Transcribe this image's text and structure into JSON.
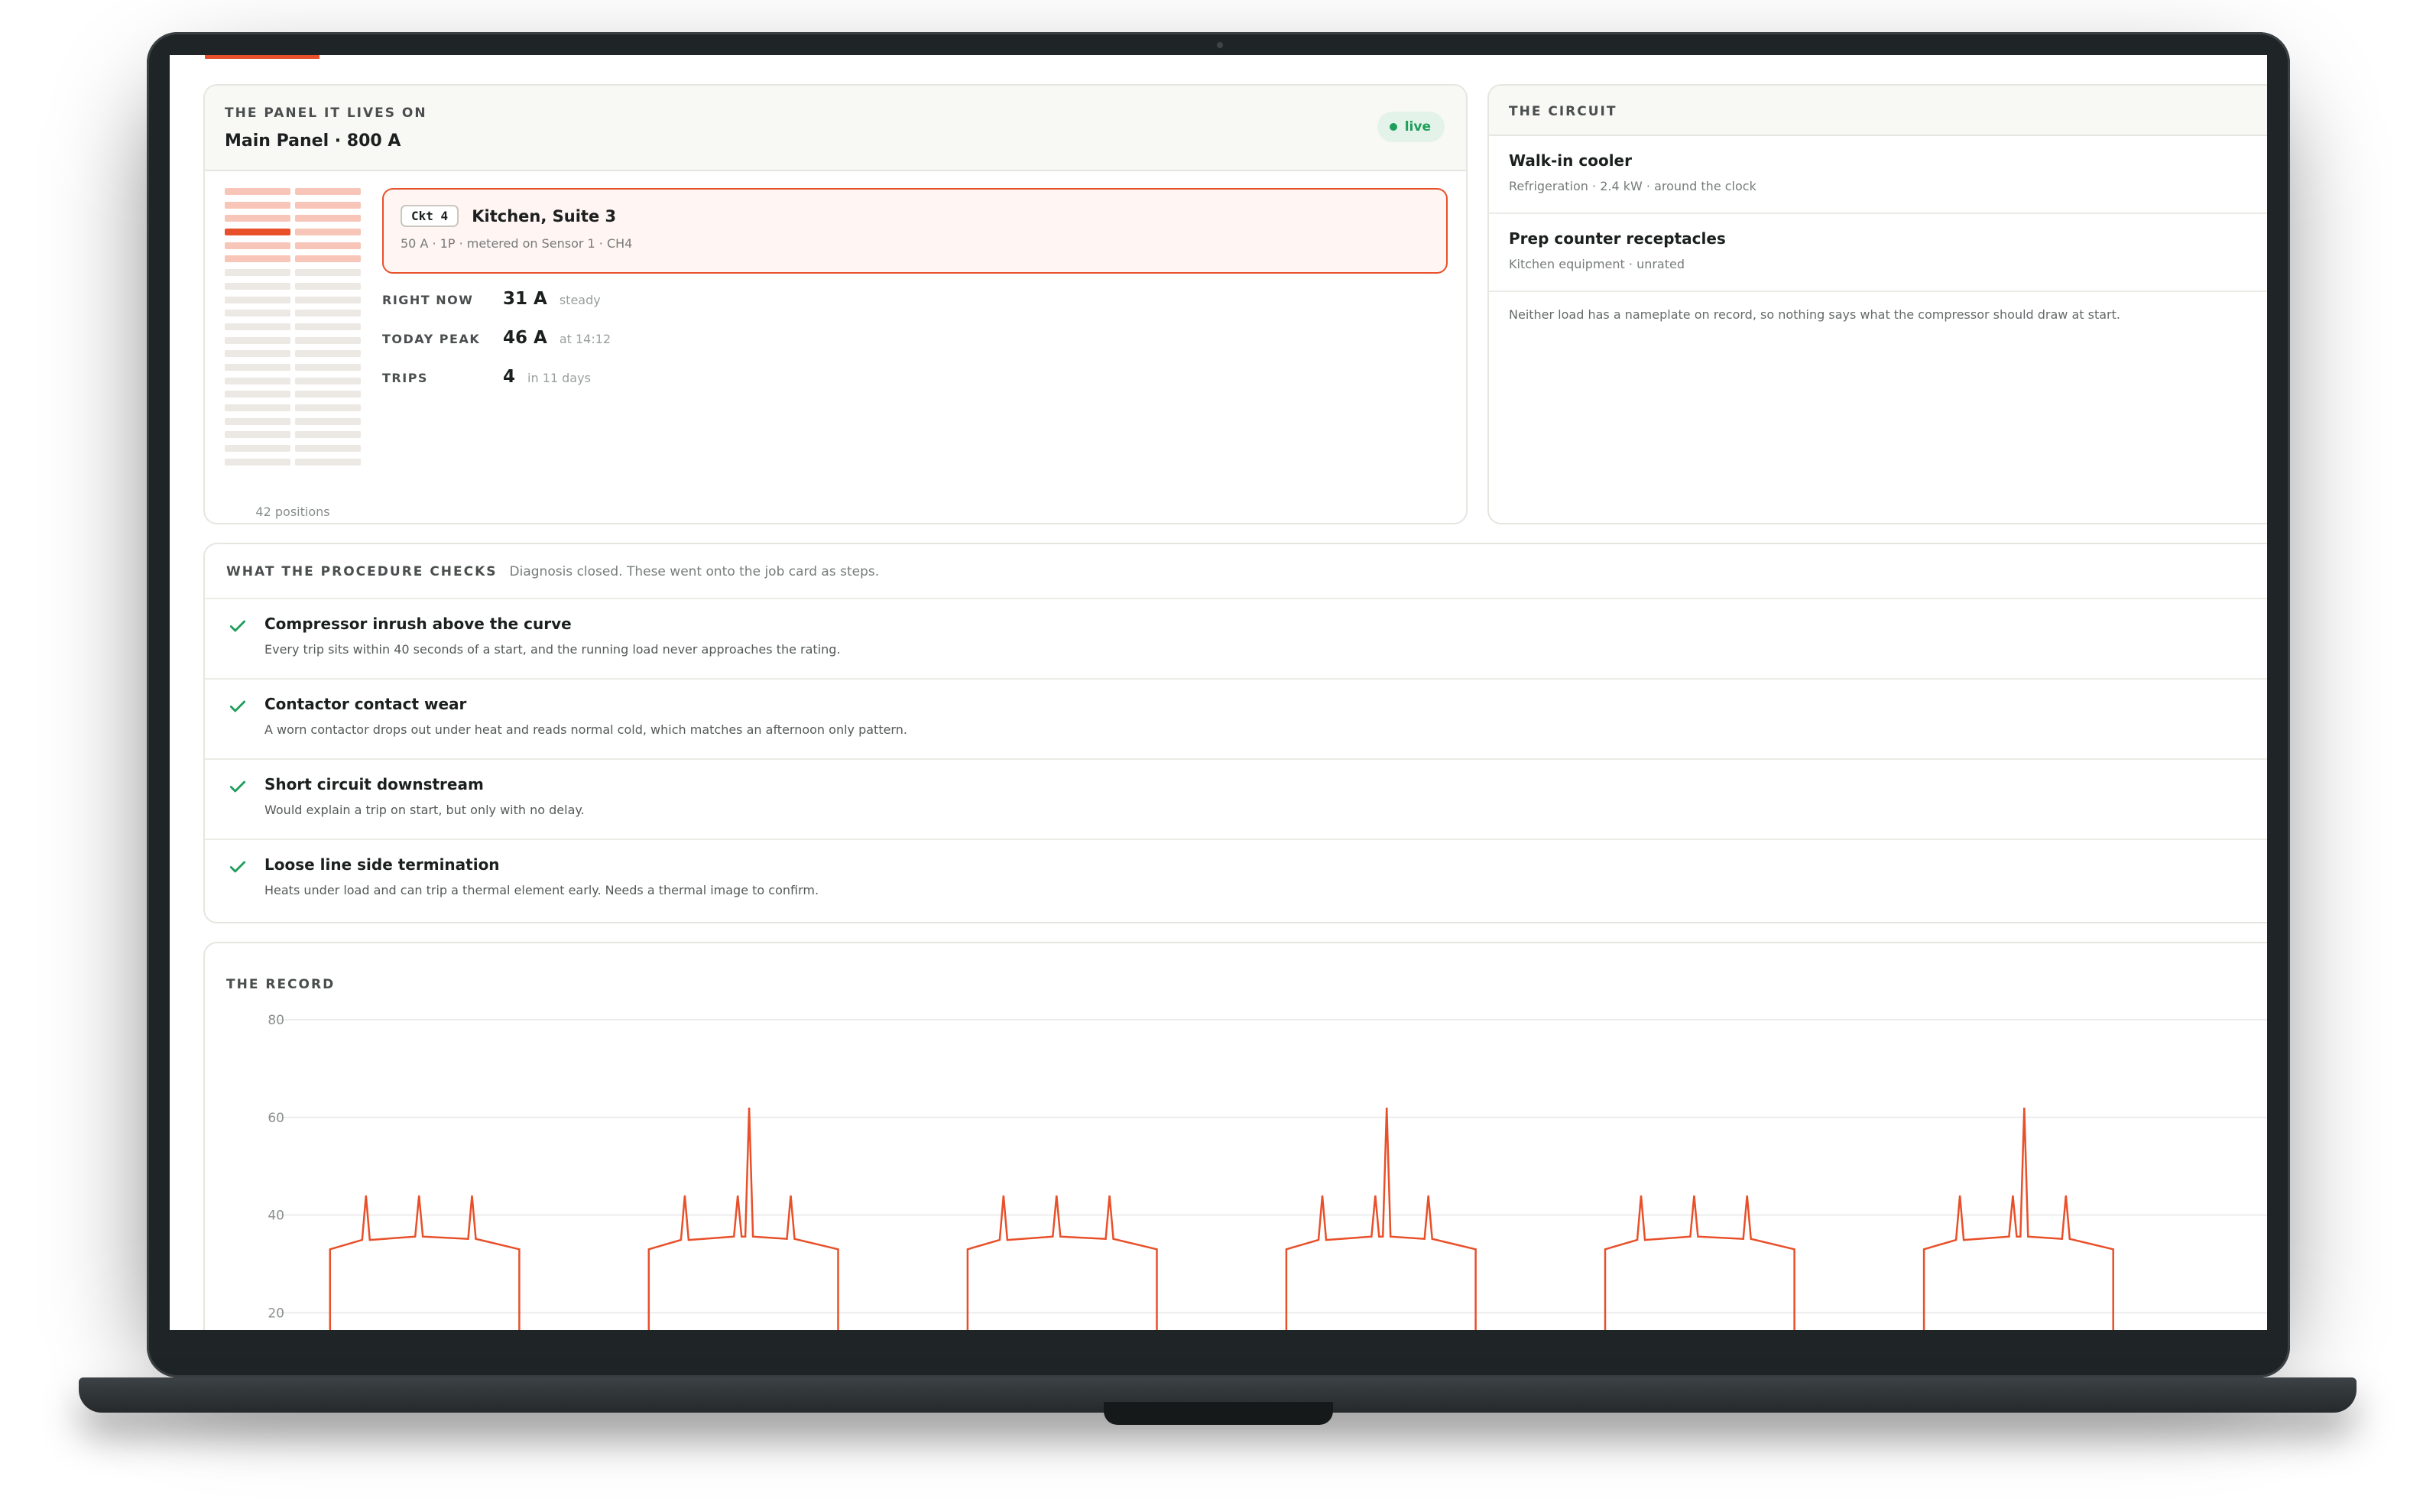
{
  "panel": {
    "eyebrow": "THE PANEL IT LIVES ON",
    "title": "Main Panel · 800 A",
    "status": "live",
    "positions_label": "42 positions",
    "active_position": 4
  },
  "circuit_box": {
    "tag": "Ckt 4",
    "name": "Kitchen, Suite 3",
    "detail": "50 A · 1P · metered on Sensor 1 · CH4"
  },
  "metrics": [
    {
      "key": "RIGHT NOW",
      "value": "31 A",
      "note": "steady"
    },
    {
      "key": "TODAY PEAK",
      "value": "46 A",
      "note": "at 14:12"
    },
    {
      "key": "TRIPS",
      "value": "4",
      "note": "in 11 days"
    }
  ],
  "circuit": {
    "eyebrow": "THE CIRCUIT",
    "loads": [
      {
        "name": "Walk-in cooler",
        "detail": "Refrigeration · 2.4 kW · around the clock"
      },
      {
        "name": "Prep counter receptacles",
        "detail": "Kitchen equipment · unrated"
      }
    ],
    "note": "Neither load has a nameplate on record, so nothing says what the compressor should draw at start."
  },
  "checks": {
    "eyebrow": "WHAT THE PROCEDURE CHECKS",
    "description": "Diagnosis closed. These went onto the job card as steps.",
    "items": [
      {
        "title": "Compressor inrush above the curve",
        "detail": "Every trip sits within 40 seconds of a start, and the running load never approaches the rating.",
        "icon": "check-icon"
      },
      {
        "title": "Contactor contact wear",
        "detail": "A worn contactor drops out under heat and reads normal cold, which matches an afternoon only pattern.",
        "icon": "check-icon"
      },
      {
        "title": "Short circuit downstream",
        "detail": "Would explain a trip on start, but only with no delay.",
        "icon": "check-icon"
      },
      {
        "title": "Loose line side termination",
        "detail": "Heats under load and can trip a thermal element early. Needs a thermal image to confirm.",
        "icon": "check-icon"
      }
    ]
  },
  "record": {
    "eyebrow": "THE RECORD"
  },
  "colors": {
    "accent": "#e8502a",
    "success": "#1f9d5a",
    "grid": "#ececec"
  },
  "chart_data": {
    "type": "line",
    "title": "",
    "xlabel": "",
    "ylabel": "",
    "y_ticks": [
      80,
      60,
      40,
      20
    ],
    "ylim": [
      8,
      80
    ],
    "x": [
      0,
      1,
      2,
      3,
      4,
      5,
      6,
      7,
      8,
      9,
      10,
      11,
      12,
      13,
      14,
      15,
      16,
      17,
      18,
      19,
      20,
      21,
      22,
      23,
      24,
      25,
      26,
      27,
      28,
      29,
      30,
      31,
      32,
      33,
      34,
      35,
      36,
      37,
      38,
      39,
      40,
      41,
      42,
      43,
      44,
      45,
      46,
      47,
      48,
      49,
      50,
      51,
      52,
      53,
      54,
      55,
      56,
      57,
      58,
      59,
      60,
      61,
      62,
      63,
      64,
      65,
      66,
      67,
      68,
      69,
      70,
      71,
      72,
      73,
      74,
      75,
      76,
      77,
      78,
      79,
      80,
      81,
      82,
      83,
      84,
      85,
      86,
      87,
      88,
      89,
      90,
      91,
      92,
      93,
      94,
      95,
      96,
      97,
      98,
      99,
      100,
      101,
      102,
      103,
      104,
      105,
      106,
      107,
      108,
      109,
      110,
      111,
      112,
      113,
      114,
      115,
      116,
      117,
      118,
      119,
      120,
      121,
      122,
      123,
      124,
      125,
      126,
      127,
      128,
      129,
      130,
      131,
      132,
      133,
      134,
      135,
      136,
      137,
      138,
      139,
      140,
      141,
      142,
      143,
      144,
      145,
      146,
      147,
      148,
      149,
      150,
      151,
      152,
      153,
      154,
      155,
      156,
      157,
      158,
      159,
      160,
      161,
      162,
      163,
      164,
      165,
      166,
      167,
      168,
      169,
      170,
      171,
      172,
      173,
      174,
      175,
      176,
      177,
      178,
      179,
      180,
      181,
      182,
      183,
      184,
      185,
      186,
      187,
      188,
      189,
      190,
      191,
      192,
      193,
      194,
      195,
      196,
      197,
      198,
      199,
      200,
      201,
      202,
      203,
      204,
      205,
      206,
      207,
      208,
      209,
      210,
      211,
      212,
      213,
      214,
      215,
      216,
      217,
      218,
      219,
      220,
      221,
      222,
      223,
      224,
      225,
      226,
      227,
      228,
      229,
      230,
      231,
      232,
      233,
      234,
      235,
      236,
      237,
      238,
      239,
      240,
      241,
      242,
      243,
      244,
      245,
      246,
      247,
      248,
      249,
      250,
      251,
      252,
      253,
      254,
      255,
      256,
      257,
      258,
      259,
      260,
      261,
      262,
      263,
      264,
      265,
      266,
      267,
      268,
      269,
      270,
      271,
      272,
      273,
      274,
      275,
      276,
      277,
      278,
      279,
      280,
      281,
      282,
      283,
      284,
      285,
      286,
      287,
      288,
      289,
      290,
      291,
      292,
      293,
      294,
      295,
      296,
      297,
      298,
      299,
      300,
      301,
      302,
      303,
      304,
      305,
      306,
      307,
      308,
      309,
      310,
      311,
      312,
      313,
      314,
      315,
      316,
      317,
      318,
      319,
      320,
      321,
      322,
      323,
      324,
      325,
      326,
      327,
      328,
      329,
      330,
      331,
      332,
      333,
      334,
      335,
      336,
      337,
      338,
      339,
      340,
      341,
      342,
      343,
      344,
      345,
      346,
      347,
      348,
      349,
      350,
      351,
      352,
      353,
      354,
      355,
      356,
      357,
      358,
      359,
      360,
      361,
      362,
      363,
      364,
      365,
      366,
      367,
      368,
      369,
      370,
      371,
      372,
      373,
      374,
      375,
      376,
      377,
      378,
      379,
      380,
      381,
      382,
      383,
      384,
      385,
      386,
      387,
      388,
      389,
      390,
      391,
      392,
      393,
      394,
      395,
      396,
      397,
      398,
      399,
      400,
      401,
      402,
      403,
      404,
      405,
      406,
      407,
      408,
      409,
      410,
      411,
      412,
      413,
      414,
      415,
      416,
      417,
      418,
      419,
      420,
      421,
      422,
      423,
      424,
      425,
      426,
      427,
      428,
      429,
      430,
      431,
      432,
      433,
      434,
      435,
      436,
      437,
      438,
      439,
      440,
      441,
      442,
      443,
      444,
      445,
      446,
      447,
      448,
      449,
      450,
      451,
      452,
      453,
      454,
      455,
      456,
      457,
      458,
      459,
      460,
      461,
      462,
      463,
      464,
      465,
      466,
      467,
      468,
      469,
      470,
      471,
      472,
      473,
      474,
      475,
      476,
      477,
      478,
      479,
      480,
      481,
      482,
      483,
      484,
      485,
      486,
      487,
      488,
      489,
      490,
      491,
      492,
      493,
      494,
      495,
      496,
      497,
      498,
      499,
      500,
      501,
      502,
      503,
      504,
      505,
      506,
      507,
      508,
      509,
      510,
      511,
      512,
      513,
      514,
      515,
      516,
      517,
      518,
      519,
      520,
      521,
      522,
      523,
      524,
      525,
      526,
      527,
      528,
      529,
      530,
      531,
      532,
      533,
      534,
      535,
      536,
      537,
      538,
      539,
      540,
      541,
      542,
      543,
      544,
      545,
      546,
      547,
      548,
      549,
      550,
      551,
      552,
      553,
      554,
      555,
      556,
      557,
      558,
      559,
      560,
      561,
      562,
      563,
      564,
      565,
      566,
      567,
      568,
      569,
      570,
      571,
      572,
      573,
      574,
      575,
      576,
      577,
      578,
      579,
      580,
      581,
      582,
      583,
      584,
      585,
      586,
      587,
      588,
      589,
      590,
      591,
      592,
      593,
      594,
      595,
      596,
      597,
      598,
      599,
      600,
      601,
      602,
      603,
      604,
      605,
      606,
      607,
      608,
      609,
      610,
      611,
      612,
      613,
      614,
      615,
      616,
      617,
      618,
      619,
      620,
      621,
      622,
      623,
      624,
      625,
      626,
      627,
      628,
      629,
      630,
      631,
      632,
      633,
      634,
      635,
      636,
      637,
      638,
      639,
      640,
      641,
      642,
      643,
      644,
      645,
      646,
      647,
      648,
      649,
      650,
      651,
      652,
      653,
      654,
      655,
      656,
      657,
      658,
      659,
      660,
      661,
      662,
      663,
      664,
      665,
      666,
      667,
      668,
      669,
      670,
      671,
      672,
      673,
      674,
      675,
      676,
      677,
      678,
      679,
      680,
      681,
      682,
      683,
      684,
      685,
      686,
      687,
      688,
      689,
      690,
      691,
      692,
      693,
      694,
      695,
      696,
      697,
      698,
      699,
      700,
      701,
      702,
      703,
      704,
      705,
      706,
      707,
      708,
      709,
      710,
      711,
      712,
      713,
      714,
      715,
      716,
      717,
      718,
      719,
      720,
      721,
      722,
      723,
      724,
      725,
      726,
      727,
      728,
      729,
      730,
      731,
      732,
      733,
      734,
      735,
      736,
      737,
      738,
      739,
      740,
      741,
      742,
      743,
      744,
      745,
      746,
      747,
      748,
      749,
      750,
      751,
      752,
      753,
      754,
      755,
      756,
      757,
      758,
      759,
      760,
      761,
      762,
      763,
      764,
      765,
      766,
      767,
      768,
      769,
      770,
      771,
      772,
      773,
      774,
      775,
      776,
      777,
      778,
      779,
      780,
      781,
      782,
      783,
      784,
      785,
      786,
      787,
      788,
      789,
      790,
      791,
      792,
      793,
      794,
      795,
      796,
      797,
      798,
      799,
      800,
      801,
      802,
      803,
      804,
      805,
      806,
      807,
      808,
      809,
      810,
      811,
      812,
      813,
      814,
      815,
      816,
      817,
      818,
      819,
      820,
      821,
      822,
      823,
      824,
      825,
      826,
      827,
      828,
      829,
      830,
      831,
      832,
      833,
      834,
      835,
      836,
      837,
      838,
      839,
      840,
      841,
      842,
      843,
      844,
      845,
      846,
      847,
      848,
      849,
      850,
      851,
      852,
      853,
      854,
      855,
      856,
      857,
      858,
      859,
      860,
      861,
      862,
      863,
      864,
      865,
      866,
      867,
      868,
      869,
      870,
      871,
      872,
      873,
      874,
      875,
      876,
      877,
      878,
      879,
      880,
      881,
      882,
      883,
      884,
      885,
      886,
      887,
      888,
      889,
      890,
      891,
      892,
      893,
      894,
      895,
      896,
      897,
      898,
      899,
      900,
      901,
      902,
      903,
      904,
      905,
      906,
      907,
      908,
      909,
      910,
      911,
      912,
      913,
      914,
      915,
      916,
      917,
      918,
      919,
      920,
      921,
      922,
      923,
      924,
      925,
      926,
      927,
      928,
      929,
      930,
      931,
      932,
      933,
      934,
      935,
      936,
      937,
      938,
      939,
      940,
      941,
      942,
      943,
      944,
      945,
      946,
      947,
      948,
      949,
      950,
      951,
      952,
      953,
      954,
      955,
      956,
      957,
      958,
      959,
      960,
      961,
      962,
      963,
      964,
      965,
      966,
      967,
      968,
      969,
      970,
      971,
      972,
      973,
      974,
      975,
      976,
      977,
      978,
      979,
      980,
      981,
      982,
      983,
      984,
      985,
      986,
      987,
      988,
      989,
      990,
      991,
      992,
      993,
      994,
      995,
      996,
      997,
      998,
      999
    ],
    "cycles": [
      {
        "start": 26,
        "end": 121,
        "running": 34,
        "spikes": [
          {
            "at": 0.19,
            "peak": 44
          },
          {
            "at": 0.47,
            "peak": 44
          },
          {
            "at": 0.75,
            "peak": 44
          }
        ]
      },
      {
        "start": 186,
        "end": 281,
        "running": 34,
        "spikes": [
          {
            "at": 0.19,
            "peak": 44
          },
          {
            "at": 0.47,
            "peak": 44
          },
          {
            "at": 0.53,
            "peak": 62
          },
          {
            "at": 0.75,
            "peak": 44
          }
        ]
      },
      {
        "start": 346,
        "end": 441,
        "running": 34,
        "spikes": [
          {
            "at": 0.19,
            "peak": 44
          },
          {
            "at": 0.47,
            "peak": 44
          },
          {
            "at": 0.75,
            "peak": 44
          }
        ]
      },
      {
        "start": 506,
        "end": 601,
        "running": 34,
        "spikes": [
          {
            "at": 0.19,
            "peak": 44
          },
          {
            "at": 0.47,
            "peak": 44
          },
          {
            "at": 0.53,
            "peak": 62
          },
          {
            "at": 0.75,
            "peak": 44
          }
        ]
      },
      {
        "start": 666,
        "end": 761,
        "running": 34,
        "spikes": [
          {
            "at": 0.19,
            "peak": 44
          },
          {
            "at": 0.47,
            "peak": 44
          },
          {
            "at": 0.75,
            "peak": 44
          }
        ]
      },
      {
        "start": 826,
        "end": 921,
        "running": 34,
        "spikes": [
          {
            "at": 0.19,
            "peak": 44
          },
          {
            "at": 0.47,
            "peak": 44
          },
          {
            "at": 0.53,
            "peak": 62
          },
          {
            "at": 0.75,
            "peak": 44
          }
        ]
      }
    ],
    "series": [
      {
        "name": "",
        "color": "#e8502a"
      }
    ],
    "grid": true,
    "legend": "none"
  }
}
